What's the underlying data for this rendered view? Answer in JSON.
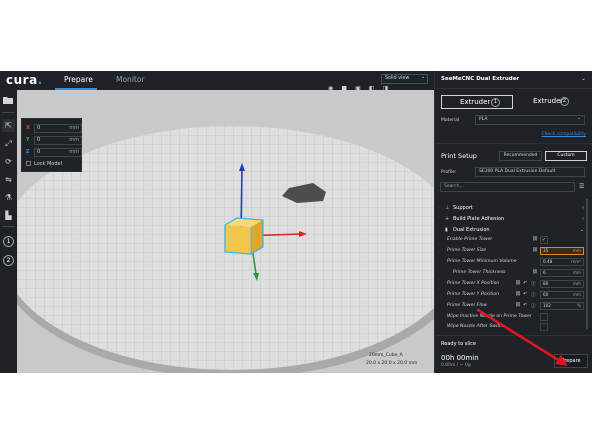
{
  "app": {
    "logo": "cura",
    "tabs": [
      {
        "label": "Prepare",
        "active": true
      },
      {
        "label": "Monitor",
        "active": false
      }
    ],
    "view_mode": "Solid view"
  },
  "move_panel": {
    "x": {
      "label": "X",
      "value": "0",
      "unit": "mm",
      "color": "#e0453a"
    },
    "y": {
      "label": "Y",
      "value": "0",
      "unit": "mm",
      "color": "#3ab04a"
    },
    "z": {
      "label": "Z",
      "value": "0",
      "unit": "mm",
      "color": "#3c89d6"
    },
    "lock_label": "Lock Model"
  },
  "model": {
    "name": "20mm_Cube_A",
    "dimensions": "20.0 x 20.0 x 20.0 mm"
  },
  "sidebar": {
    "printer": "SeeMeCNC Dual Extruder",
    "extruders": [
      {
        "label": "Extruder",
        "number": "1",
        "active": true
      },
      {
        "label": "Extruder",
        "number": "2",
        "active": false
      }
    ],
    "material_label": "Material",
    "material_value": "PLA",
    "check_compat": "Check compatibility",
    "print_setup": "Print Setup",
    "recommended": "Recommended",
    "custom": "Custom",
    "profile_label": "Profile:",
    "profile_value": "SE300 PLA Dual Extrusion Default",
    "search_placeholder": "Search...",
    "categories": [
      {
        "label": "Support"
      },
      {
        "label": "Build Plate Adhesion"
      },
      {
        "label": "Dual Extrusion"
      }
    ],
    "settings": [
      {
        "label": "Enable Prime Tower",
        "value": "✓"
      },
      {
        "label": "Prime Tower Size",
        "value": "35",
        "unit": "mm"
      },
      {
        "label": "Prime Tower Minimum Volume",
        "value": "0.48",
        "unit": "mm³"
      },
      {
        "label": "Prime Tower Thickness",
        "value": "6",
        "unit": "mm"
      },
      {
        "label": "Prime Tower X Position",
        "value": "80",
        "unit": "mm"
      },
      {
        "label": "Prime Tower Y Position",
        "value": "60",
        "unit": "mm"
      },
      {
        "label": "Prime Tower Flow",
        "value": "102",
        "unit": "%"
      },
      {
        "label": "Wipe Inactive Nozzle on Prime Tower"
      },
      {
        "label": "Wipe Nozzle After Switch"
      }
    ],
    "ready_label": "Ready to slice",
    "time": "00h 00min",
    "usage": "0.00m / ~ 0g",
    "prepare_button": "Prepare"
  },
  "colors": {
    "accent": "#3c89d6",
    "modified_value": "#d98a2b",
    "annotation_arrow": "#e0141e",
    "model_yellow": "#f2c64a",
    "model_outline": "#39b7e6"
  }
}
